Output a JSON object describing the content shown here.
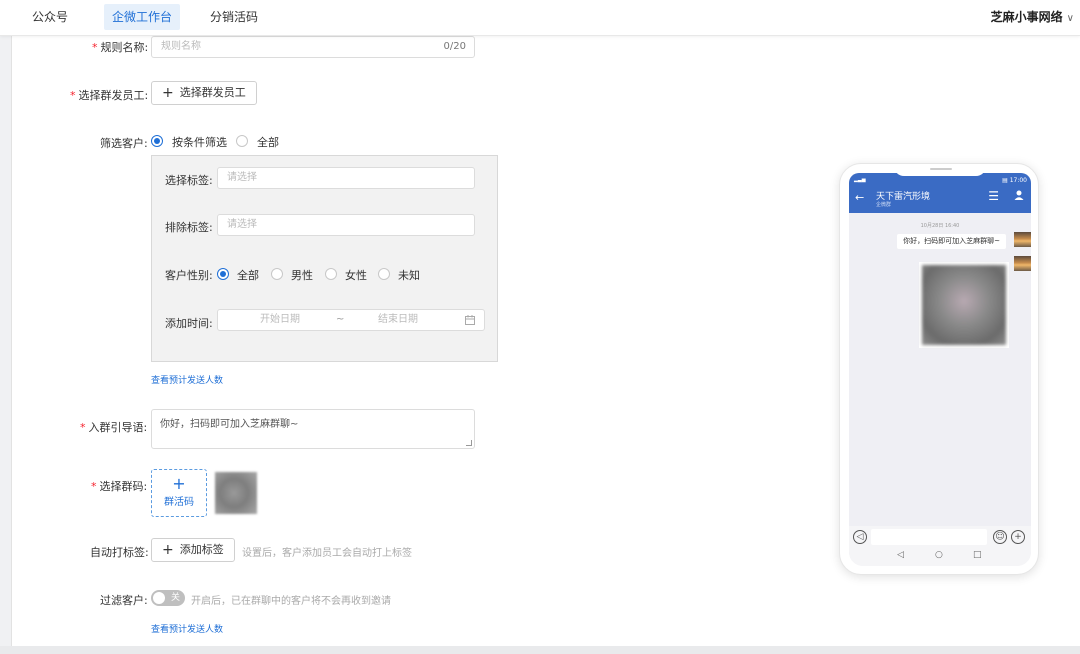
{
  "nav": {
    "tabs": [
      "公众号",
      "企微工作台",
      "分销活码"
    ],
    "active_index": 1,
    "account": "芝麻小事网络",
    "account_chevron": "∨"
  },
  "form": {
    "rule_name": {
      "label": "规则名称:",
      "placeholder": "规则名称",
      "counter": "0/20"
    },
    "group_staff": {
      "label": "选择群发员工:",
      "button": "选择群发员工"
    },
    "filter_customers": {
      "label": "筛选客户:",
      "options": [
        "按条件筛选",
        "全部"
      ],
      "selected": 0
    },
    "filter_box": {
      "tags": {
        "label": "选择标签:",
        "placeholder": "请选择"
      },
      "exclude_tags": {
        "label": "排除标签:",
        "placeholder": "请选择"
      },
      "gender": {
        "label": "客户性别:",
        "options": [
          "全部",
          "男性",
          "女性",
          "未知"
        ],
        "selected": 0
      },
      "add_time": {
        "label": "添加时间:",
        "start_placeholder": "开始日期",
        "separator": "~",
        "end_placeholder": "结束日期"
      }
    },
    "view_count_link_1": "查看预计发送人数",
    "guide_text": {
      "label": "入群引导语:",
      "value": "你好，扫码即可加入芝麻群聊~"
    },
    "group_code": {
      "label": "选择群码:",
      "add_label": "群活码",
      "add_plus": "+"
    },
    "auto_tag": {
      "label": "自动打标签:",
      "button": "添加标签",
      "hint": "设置后，客户添加员工会自动打上标签"
    },
    "filter_switch": {
      "label": "过滤客户:",
      "state_text": "关",
      "hint": "开启后，已在群聊中的客户将不会再收到邀请"
    },
    "view_count_link_2": "查看预计发送人数"
  },
  "phone": {
    "status": "▤ 17:00",
    "signal": "▂▃▅",
    "chat_name": "天下雷汽形境",
    "chat_sub": "企微群",
    "timestamp": "10月28日 16:40",
    "message": "你好，扫码即可加入芝麻群聊~",
    "nav_icons": [
      "◁",
      "○",
      "□"
    ]
  },
  "colors": {
    "accent": "#1f6fd6",
    "phone_header": "#3a6bc4",
    "required": "#f5222d"
  }
}
